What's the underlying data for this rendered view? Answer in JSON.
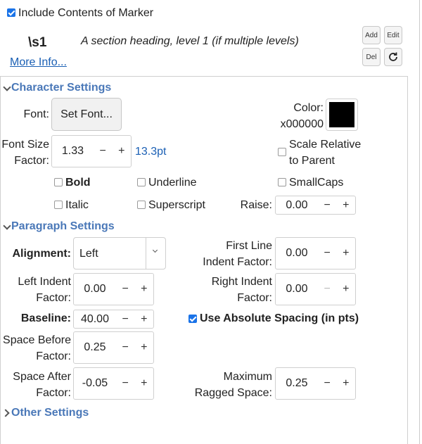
{
  "header": {
    "include_label": "Include Contents of Marker",
    "include_checked": true,
    "marker": "\\s1",
    "description": "A section heading, level 1 (if multiple levels)",
    "more_info": "More Info...",
    "buttons": {
      "add": "Add",
      "edit": "Edit",
      "del": "Del",
      "refresh_icon": "refresh-icon"
    }
  },
  "character": {
    "title": "Character Settings",
    "font_label": "Font:",
    "set_font_button": "Set Font...",
    "color_label": "Color:",
    "color_value": "x000000",
    "color_hex": "#000000",
    "font_size_label_1": "Font Size",
    "font_size_label_2": "Factor:",
    "font_size_value": "1.33",
    "font_size_pt": "13.3pt",
    "scale_relative_1": "Scale Relative",
    "scale_relative_2": "to Parent",
    "bold": "Bold",
    "underline": "Underline",
    "smallcaps": "SmallCaps",
    "italic": "Italic",
    "superscript": "Superscript",
    "raise_label": "Raise:",
    "raise_value": "0.00"
  },
  "paragraph": {
    "title": "Paragraph Settings",
    "alignment_label": "Alignment:",
    "alignment_value": "Left",
    "first_line_1": "First Line",
    "first_line_2": "Indent Factor:",
    "first_line_value": "0.00",
    "left_indent_1": "Left Indent",
    "left_indent_2": "Factor:",
    "left_indent_value": "0.00",
    "right_indent_1": "Right Indent",
    "right_indent_2": "Factor:",
    "right_indent_value": "0.00",
    "baseline_label": "Baseline:",
    "baseline_value": "40.00",
    "absolute_spacing": "Use Absolute Spacing (in pts)",
    "space_before_1": "Space Before",
    "space_before_2": "Factor:",
    "space_before_value": "0.25",
    "space_after_1": "Space After",
    "space_after_2": "Factor:",
    "space_after_value": "-0.05",
    "max_ragged_1": "Maximum",
    "max_ragged_2": "Ragged Space:",
    "max_ragged_value": "0.25"
  },
  "other": {
    "title": "Other Settings"
  },
  "spin_minus": "−",
  "spin_plus": "+"
}
